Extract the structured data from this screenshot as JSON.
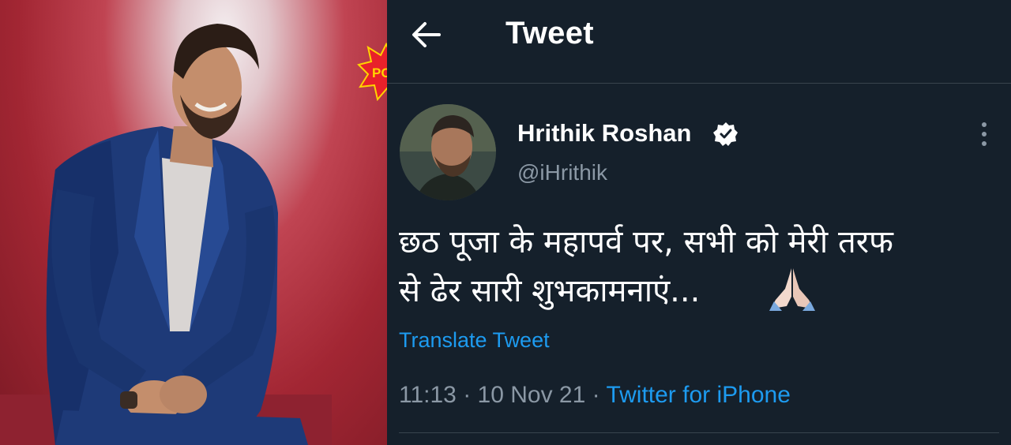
{
  "header": {
    "title": "Tweet"
  },
  "tweet": {
    "author": {
      "display_name": "Hrithik Roshan",
      "handle": "@iHrithik",
      "verified": true
    },
    "text_lines": [
      "छठ पूजा के महापर्व पर, सभी को मेरी तरफ",
      "से ढेर सारी शुभकामनाएं..."
    ],
    "emoji": "folded-hands-icon",
    "translate_label": "Translate Tweet",
    "time": "11:13",
    "date": "10 Nov 21",
    "separator": "·",
    "source": "Twitter for iPhone"
  },
  "watermark": {
    "logo_text": "POP"
  },
  "colors": {
    "background": "#15202b",
    "divider": "#38444d",
    "secondary_text": "#8b98a5",
    "link": "#1d9bf0",
    "photo_backdrop": "#a22633"
  }
}
